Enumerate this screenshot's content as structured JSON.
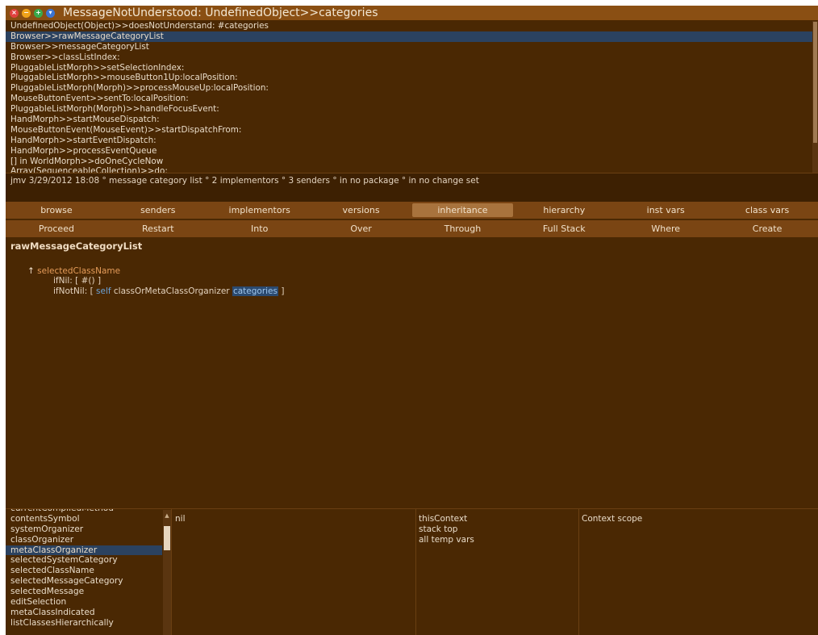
{
  "window": {
    "title": "MessageNotUnderstood: UndefinedObject>>categories",
    "controls": [
      "close-icon",
      "minimize-icon",
      "expand-icon",
      "menu-icon"
    ]
  },
  "stack": {
    "items": [
      "UndefinedObject(Object)>>doesNotUnderstand: #categories",
      "Browser>>rawMessageCategoryList",
      "Browser>>messageCategoryList",
      "Browser>>classListIndex:",
      "PluggableListMorph>>setSelectionIndex:",
      "PluggableListMorph>>mouseButton1Up:localPosition:",
      "PluggableListMorph(Morph)>>processMouseUp:localPosition:",
      "MouseButtonEvent>>sentTo:localPosition:",
      "PluggableListMorph(Morph)>>handleFocusEvent:",
      "HandMorph>>startMouseDispatch:",
      "MouseButtonEvent(MouseEvent)>>startDispatchFrom:",
      "HandMorph>>startEventDispatch:",
      "HandMorph>>processEventQueue",
      "[] in WorldMorph>>doOneCycleNow",
      "Array(SequenceableCollection)>>do:"
    ],
    "selected_index": 1
  },
  "info": "jmv 3/29/2012 18:08 ° message category list ° 2 implementors ° 3 senders ° in no package ° in no change set",
  "toolbar1": [
    "browse",
    "senders",
    "implementors",
    "versions",
    "inheritance",
    "hierarchy",
    "inst vars",
    "class vars"
  ],
  "toolbar1_highlighted": "inheritance",
  "toolbar2": [
    "Proceed",
    "Restart",
    "Into",
    "Over",
    "Through",
    "Full Stack",
    "Where",
    "Create"
  ],
  "code": {
    "selector": "rawMessageCategoryList",
    "caret": "↑",
    "receiver": "selectedClassName",
    "line2": "ifNil: [ #() ]",
    "line3_prefix": "ifNotNil: [",
    "self_kw": "self",
    "line3_mid": "classOrMetaClassOrganizer",
    "highlighted": "categories",
    "line3_end": "]"
  },
  "variables": {
    "items": [
      "currentCompiledMethod",
      "contentsSymbol",
      "systemOrganizer",
      "classOrganizer",
      "metaClassOrganizer",
      "selectedSystemCategory",
      "selectedClassName",
      "selectedMessageCategory",
      "selectedMessage",
      "editSelection",
      "metaClassIndicated",
      "listClassesHierarchically"
    ],
    "selected_index": 4,
    "value": "nil"
  },
  "context": {
    "items": [
      "thisContext",
      "stack top",
      "all temp vars"
    ],
    "scope_label": "Context scope"
  },
  "colors": {
    "background": "#4a2803",
    "titlebar": "#8a4f13",
    "toolbar": "#7a4513",
    "selection": "#2b4260"
  }
}
